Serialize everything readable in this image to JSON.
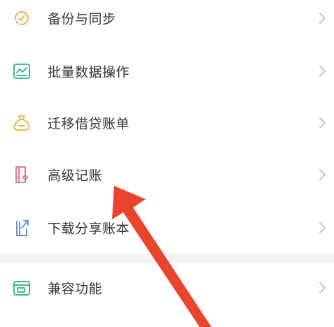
{
  "menu": {
    "items": [
      {
        "label": "备份与同步",
        "icon": "sync-clock-icon",
        "color": "#e8b84a"
      },
      {
        "label": "批量数据操作",
        "icon": "chart-card-icon",
        "color": "#3fb98a"
      },
      {
        "label": "迁移借贷账单",
        "icon": "money-bag-icon",
        "color": "#e8b84a"
      },
      {
        "label": "高级记账",
        "icon": "book-heart-icon",
        "color": "#e57a8c"
      },
      {
        "label": "下载分享账本",
        "icon": "share-book-icon",
        "color": "#6b8fd6"
      }
    ],
    "secondary_items": [
      {
        "label": "兼容功能",
        "icon": "compat-window-icon",
        "color": "#3fb98a"
      }
    ]
  },
  "colors": {
    "annotation_arrow": "#e8442e"
  }
}
